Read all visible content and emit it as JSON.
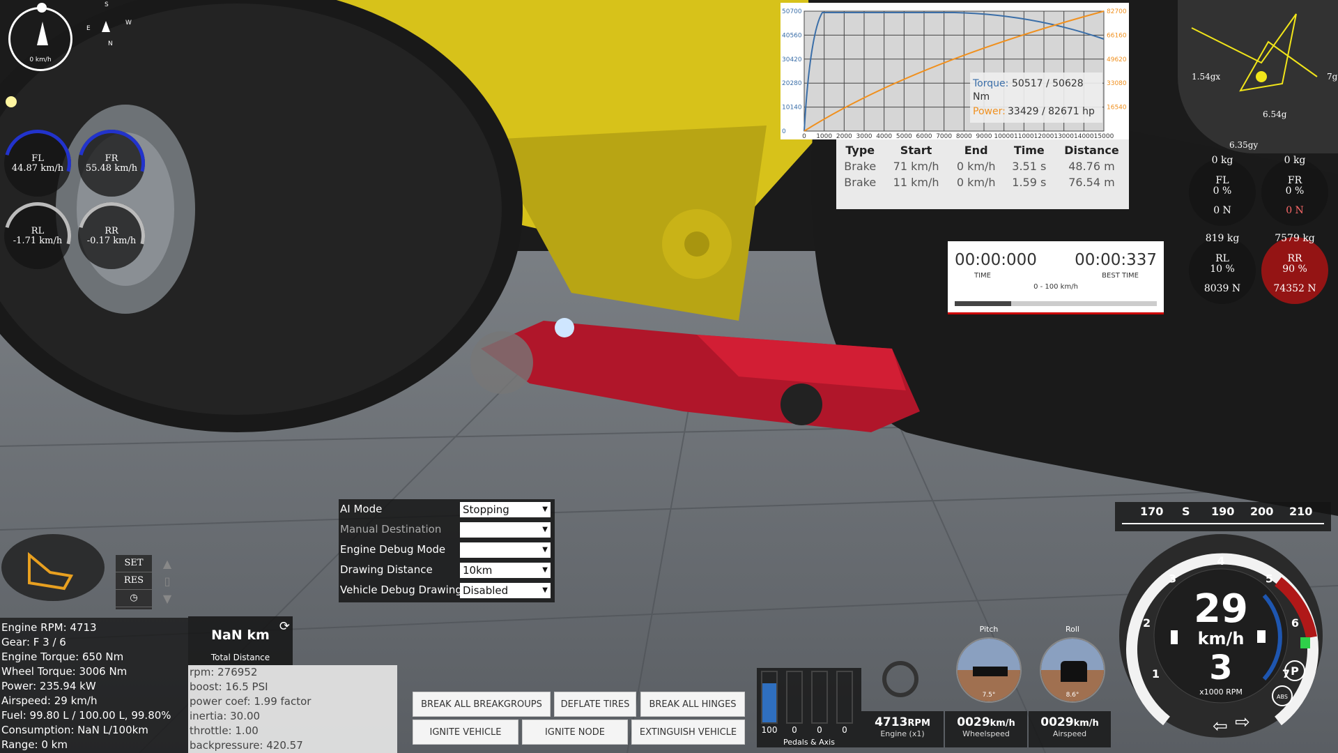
{
  "hud": {
    "compass_speed": "0 km/h",
    "mini_compass": {
      "s": "S",
      "e": "E",
      "w": "W",
      "n": "N"
    },
    "wheels": [
      {
        "id": "FL",
        "label": "FL",
        "value": "44.87 km/h"
      },
      {
        "id": "FR",
        "label": "FR",
        "value": "55.48 km/h"
      },
      {
        "id": "RL",
        "label": "RL",
        "value": "-1.71 km/h"
      },
      {
        "id": "RR",
        "label": "RR",
        "value": "-0.17 km/h"
      }
    ],
    "gforce": {
      "x": "1.54gx",
      "y": "6.35gy",
      "g": "6.54g",
      "right": "7g"
    },
    "tires": [
      {
        "id": "FL",
        "kg": "0 kg",
        "label": "FL",
        "pct": "0 %",
        "force": "0 N"
      },
      {
        "id": "FR",
        "kg": "0 kg",
        "label": "FR",
        "pct": "0 %",
        "force": "0 N"
      },
      {
        "id": "RL",
        "kg": "819 kg",
        "label": "RL",
        "pct": "10 %",
        "force": "8039 N"
      },
      {
        "id": "RR",
        "kg": "7579 kg",
        "label": "RR",
        "pct": "90 %",
        "force": "74352 N"
      }
    ]
  },
  "torque_graph": {
    "y_left_ticks": [
      "50700",
      "40560",
      "30420",
      "20280",
      "10140",
      "0"
    ],
    "y_right_ticks": [
      "82700",
      "66160",
      "49620",
      "33080",
      "16540"
    ],
    "x_ticks": [
      "0",
      "1000",
      "2000",
      "3000",
      "4000",
      "5000",
      "6000",
      "7000",
      "8000",
      "9000",
      "10000",
      "11000",
      "12000",
      "13000",
      "14000",
      "15000"
    ],
    "tooltip": {
      "torque_label": "Torque:",
      "torque_value": "50517 / 50628",
      "torque_unit": "Nm",
      "power_label": "Power:",
      "power_value": "33429 / 82671 hp"
    },
    "colors": {
      "torque": "#3a6ea8",
      "power": "#f0901e"
    }
  },
  "trip_table": {
    "headers": [
      "Type",
      "Start",
      "End",
      "Time",
      "Distance"
    ],
    "rows": [
      [
        "Brake",
        "71 km/h",
        "0 km/h",
        "3.51 s",
        "48.76 m"
      ],
      [
        "Brake",
        "11 km/h",
        "0 km/h",
        "1.59 s",
        "76.54 m"
      ]
    ]
  },
  "timer": {
    "time": "00:00:000",
    "time_label": "TIME",
    "best": "00:00:337",
    "best_label": "BEST TIME",
    "range": "0 - 100 km/h",
    "progress": 0.28
  },
  "debug_panel": {
    "rows": [
      {
        "label": "AI Mode",
        "value": "Stopping",
        "dim": false
      },
      {
        "label": "Manual Destination",
        "value": "",
        "dim": true
      },
      {
        "label": "Engine Debug Mode",
        "value": "",
        "dim": false
      },
      {
        "label": "Drawing Distance",
        "value": "10km",
        "dim": false
      },
      {
        "label": "Vehicle Debug Drawing",
        "value": "Disabled",
        "dim": false
      }
    ]
  },
  "engine_info": [
    "Engine RPM: 4713",
    "Gear: F 3 / 6",
    "Engine Torque: 650 Nm",
    "Wheel Torque: 3006 Nm",
    "Power: 235.94 kW",
    "Airspeed: 29 km/h",
    "Fuel: 99.80 L / 100.00 L, 99.80%",
    "Consumption: NaN L/100km",
    "Range: 0 km"
  ],
  "tripmeter": {
    "value": "NaN km",
    "label": "Total Distance"
  },
  "tuning": [
    "rpm: 276952",
    "boost: 16.5 PSI",
    "power coef: 1.99 factor",
    "inertia: 30.00",
    "throttle: 1.00",
    "backpressure: 420.57"
  ],
  "cruise": {
    "set": "SET",
    "res": "RES"
  },
  "actions": {
    "break_breakgroups": "BREAK ALL BREAKGROUPS",
    "deflate_tires": "DEFLATE TIRES",
    "break_hinges": "BREAK ALL HINGES",
    "ignite_vehicle": "IGNITE VEHICLE",
    "ignite_node": "IGNITE NODE",
    "extinguish_vehicle": "EXTINGUISH VEHICLE"
  },
  "pedals": {
    "values": [
      "100",
      "0",
      "0",
      "0"
    ],
    "fills": [
      0.78,
      0,
      0,
      0
    ],
    "label": "Pedals & Axis"
  },
  "attitude": {
    "pitch_label": "Pitch",
    "roll_label": "Roll",
    "pitch_value": "7.5°",
    "roll_value": "8.6°"
  },
  "readouts": {
    "rpm": {
      "value": "4713",
      "unit": "RPM",
      "label": "Engine (x1)"
    },
    "wheelspeed": {
      "value": "0029",
      "unit": "km/h",
      "label": "Wheelspeed"
    },
    "airspeed": {
      "value": "0029",
      "unit": "km/h",
      "label": "Airspeed"
    }
  },
  "speed_strip": [
    "170",
    "S",
    "190",
    "200",
    "210"
  ],
  "dash": {
    "speed": "29",
    "unit": "km/h",
    "gear": "3",
    "rpm_label": "x1000 RPM",
    "rpm_ticks": [
      "1",
      "2",
      "3",
      "4",
      "5",
      "6",
      "7"
    ],
    "p_label": "P",
    "abs_label": "ABS"
  }
}
